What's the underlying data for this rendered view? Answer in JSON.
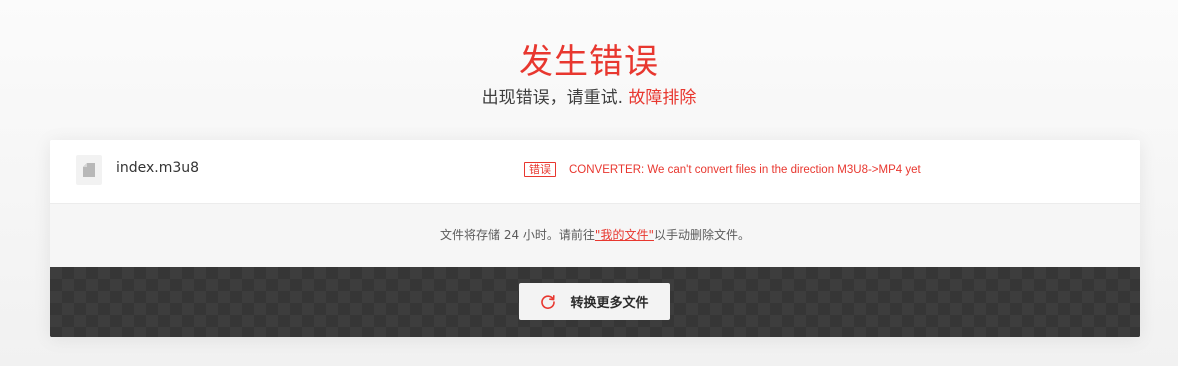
{
  "header": {
    "title": "发生错误",
    "subtitle": "出现错误，请重试.",
    "troubleshoot_link": "故障排除"
  },
  "file": {
    "name": "index.m3u8",
    "status_badge": "错误",
    "error_message": "CONVERTER: We can't convert files in the direction M3U8->MP4 yet"
  },
  "notice": {
    "before": "文件将存储 24 小时。请前往",
    "link": "\"我的文件\"",
    "after": "以手动删除文件。"
  },
  "actions": {
    "convert_more_label": "转换更多文件"
  },
  "colors": {
    "accent": "#e8372f",
    "dark_panel": "#3d3d3d"
  },
  "icons": {
    "file": "file-icon",
    "refresh": "refresh-icon"
  }
}
